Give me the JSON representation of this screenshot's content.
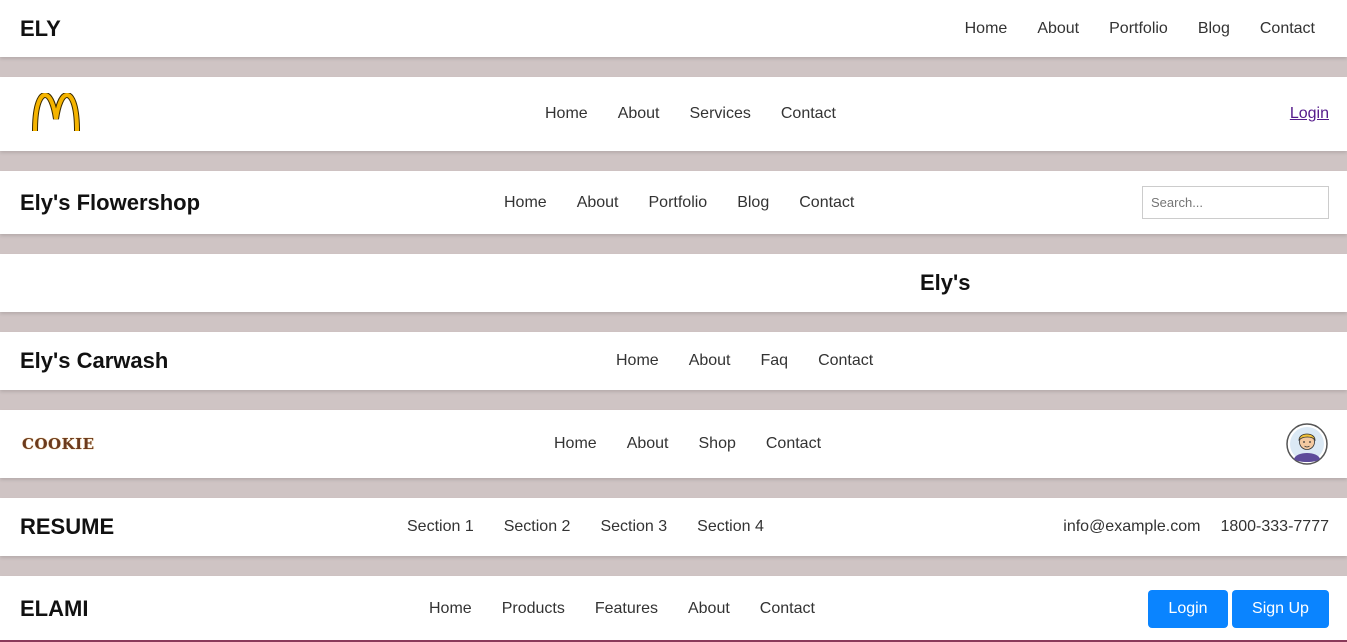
{
  "nav1": {
    "brand": "ELY",
    "links": [
      "Home",
      "About",
      "Portfolio",
      "Blog",
      "Contact"
    ]
  },
  "nav2": {
    "logo_icon": "mcdonalds-arches-icon",
    "links": [
      "Home",
      "About",
      "Services",
      "Contact"
    ],
    "login": "Login"
  },
  "nav3": {
    "brand": "Ely's Flowershop",
    "links": [
      "Home",
      "About",
      "Portfolio",
      "Blog",
      "Contact"
    ],
    "search_placeholder": "Search..."
  },
  "nav4": {
    "brand": "Ely's",
    "menu_icon": "hamburger-icon"
  },
  "nav5": {
    "brand": "Ely's Carwash",
    "links": [
      "Home",
      "About",
      "Faq",
      "Contact"
    ],
    "menu_icon": "hamburger-icon"
  },
  "nav6": {
    "logo_text": "COOKIE",
    "links": [
      "Home",
      "About",
      "Shop",
      "Contact"
    ],
    "avatar_icon": "avatar-icon"
  },
  "nav7": {
    "brand": "RESUME",
    "links": [
      "Section 1",
      "Section 2",
      "Section 3",
      "Section 4"
    ],
    "email": "info@example.com",
    "phone": "1800-333-7777"
  },
  "nav8": {
    "brand": "ELAMI",
    "links": [
      "Home",
      "Products",
      "Features",
      "About",
      "Contact"
    ],
    "login": "Login",
    "signup": "Sign Up"
  },
  "colors": {
    "page_bg": "#cfc4c4",
    "bar_bg": "#ffffff",
    "accent_blue": "#0a84ff",
    "link_purple": "#551a8b",
    "arches_yellow": "#f5b400"
  }
}
